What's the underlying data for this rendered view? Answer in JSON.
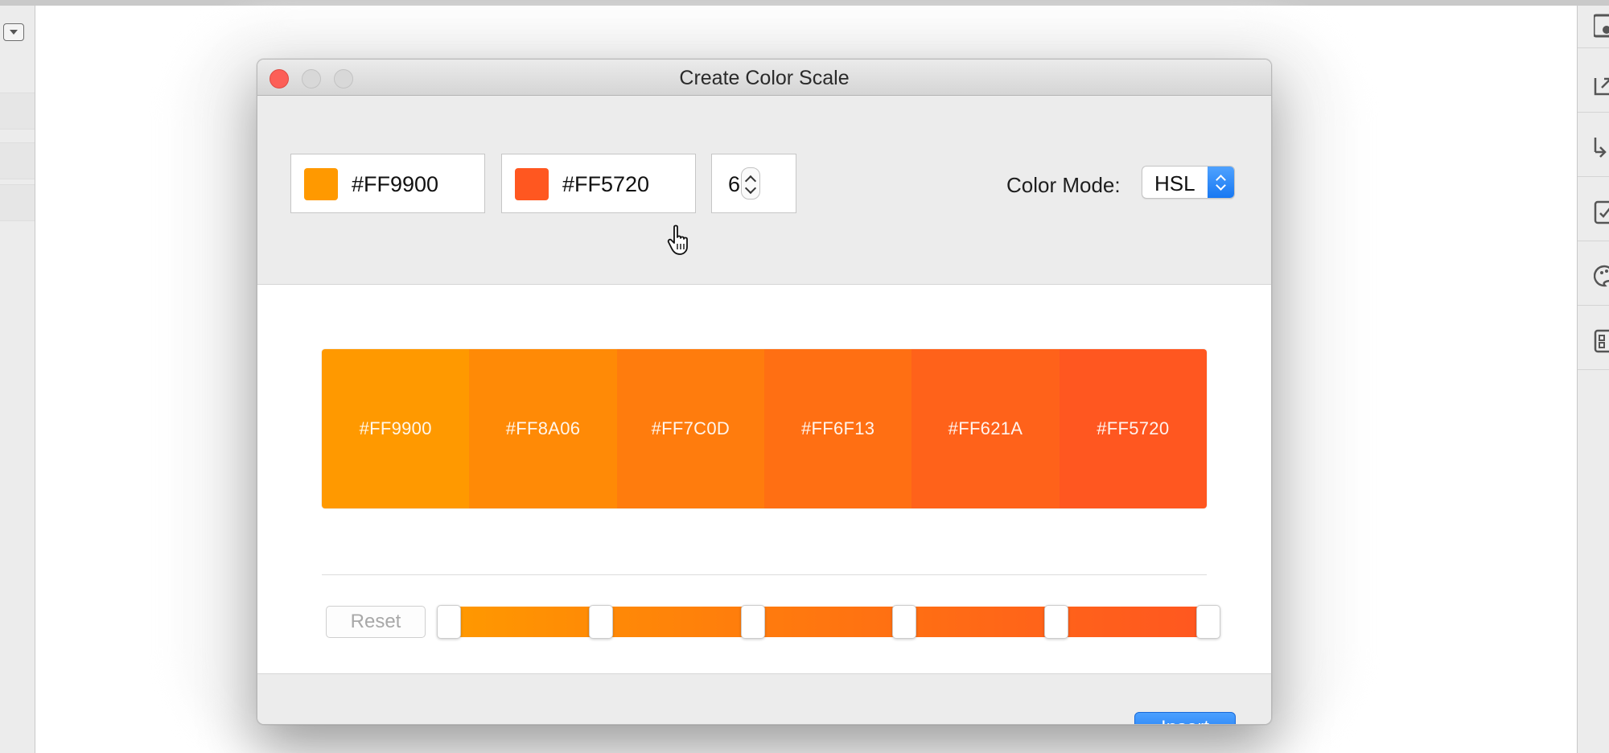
{
  "dialog": {
    "title": "Create Color Scale",
    "start_color": {
      "hex": "#FF9900",
      "label": "#FF9900"
    },
    "end_color": {
      "hex": "#FF5720",
      "label": "#FF5720"
    },
    "steps": "6",
    "color_mode_label": "Color Mode:",
    "color_mode_value": "HSL",
    "reset_label": "Reset",
    "insert_label": "Insert"
  },
  "scale": [
    {
      "hex": "#FF9900",
      "label": "#FF9900"
    },
    {
      "hex": "#FF8A06",
      "label": "#FF8A06"
    },
    {
      "hex": "#FF7C0D",
      "label": "#FF7C0D"
    },
    {
      "hex": "#FF6F13",
      "label": "#FF6F13"
    },
    {
      "hex": "#FF621A",
      "label": "#FF621A"
    },
    {
      "hex": "#FF5720",
      "label": "#FF5720"
    }
  ],
  "slider": {
    "stops": [
      0,
      0.2,
      0.4,
      0.6,
      0.8,
      1.0
    ]
  },
  "colors": {
    "accent": "#1a7cf5",
    "close": "#fc5f57"
  }
}
